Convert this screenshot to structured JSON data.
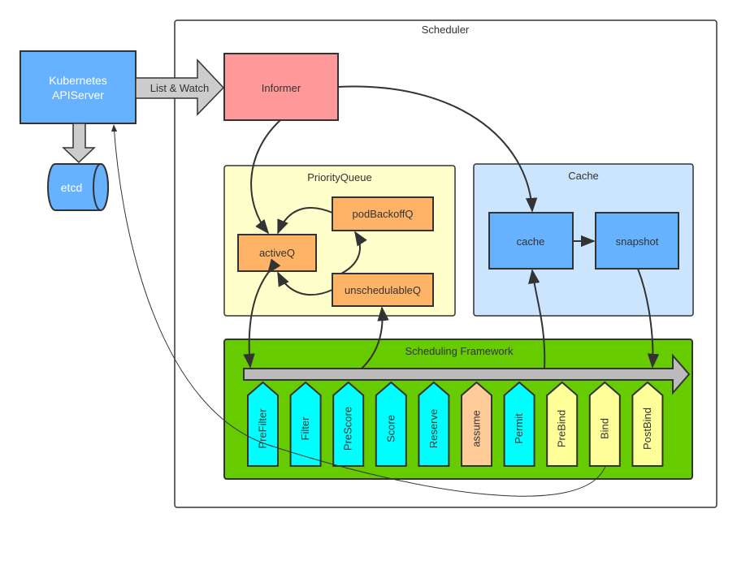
{
  "scheduler": {
    "title": "Scheduler"
  },
  "apiserver": {
    "line1": "Kubernetes",
    "line2": "APIServer"
  },
  "etcd": {
    "label": "etcd"
  },
  "list_watch": {
    "label": "List & Watch"
  },
  "informer": {
    "label": "Informer"
  },
  "priority_queue": {
    "title": "PriorityQueue",
    "active": "activeQ",
    "backoff": "podBackoffQ",
    "unschedulable": "unschedulableQ"
  },
  "cache_group": {
    "title": "Cache",
    "cache": "cache",
    "snapshot": "snapshot"
  },
  "framework": {
    "title": "Scheduling Framework",
    "phases": [
      {
        "label": "PreFilter",
        "color": "#00ffff"
      },
      {
        "label": "Filter",
        "color": "#00ffff"
      },
      {
        "label": "PreScore",
        "color": "#00ffff"
      },
      {
        "label": "Score",
        "color": "#00ffff"
      },
      {
        "label": "Reserve",
        "color": "#00ffff"
      },
      {
        "label": "assume",
        "color": "#ffcc99"
      },
      {
        "label": "Permit",
        "color": "#00ffff"
      },
      {
        "label": "PreBind",
        "color": "#ffff99"
      },
      {
        "label": "Bind",
        "color": "#ffff99"
      },
      {
        "label": "PostBind",
        "color": "#ffff99"
      }
    ]
  },
  "colors": {
    "apiserver": "#66b2ff",
    "informer": "#ff9999",
    "priority_queue": "#ffffcc",
    "queue_item": "#ffb366",
    "cache_group": "#cce5ff",
    "cache_item": "#66b2ff",
    "framework": "#66cc00",
    "arrow_gray": "#c0c0c0"
  }
}
